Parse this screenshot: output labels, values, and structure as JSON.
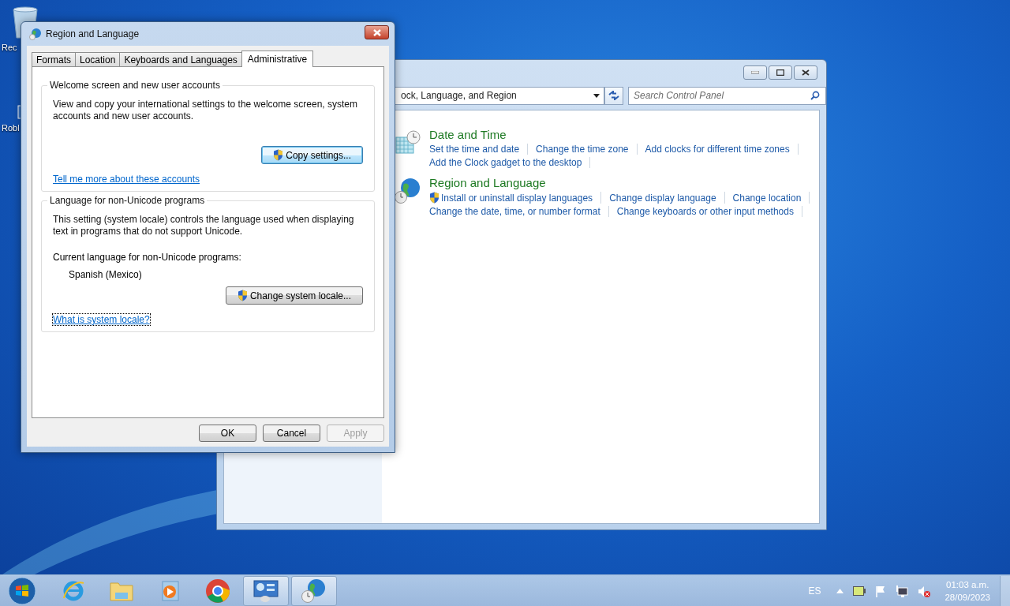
{
  "desktop_icons": [
    {
      "kind": "recycle-bin",
      "label": "Rec"
    },
    {
      "kind": "shortcut",
      "label": "Robl"
    }
  ],
  "control_panel": {
    "address": "ock, Language, and Region",
    "search": {
      "placeholder": "Search Control Panel"
    },
    "categories": [
      {
        "kind": "clock",
        "title": "Date and Time",
        "link_rows": [
          [
            {
              "label": "Set the time and date",
              "shield": false
            },
            {
              "label": "Change the time zone",
              "shield": false
            },
            {
              "label": "Add clocks for different time zones",
              "shield": false
            }
          ],
          [
            {
              "label": "Add the Clock gadget to the desktop",
              "shield": false
            }
          ]
        ]
      },
      {
        "kind": "globe",
        "title": "Region and Language",
        "link_rows": [
          [
            {
              "label": "Install or uninstall display languages",
              "shield": true
            },
            {
              "label": "Change display language",
              "shield": false
            },
            {
              "label": "Change location",
              "shield": false
            }
          ],
          [
            {
              "label": "Change the date, time, or number format",
              "shield": false
            },
            {
              "label": "Change keyboards or other input methods",
              "shield": false
            }
          ]
        ]
      }
    ]
  },
  "dialog": {
    "title": "Region and Language",
    "tabs": [
      {
        "label": "Formats",
        "selected": false
      },
      {
        "label": "Location",
        "selected": false
      },
      {
        "label": "Keyboards and Languages",
        "selected": false
      },
      {
        "label": "Administrative",
        "selected": true
      }
    ],
    "groups": [
      {
        "legend": "Welcome screen and new user accounts",
        "text": "View and copy your international settings to the welcome screen, system accounts and new user accounts.",
        "button": {
          "label": "Copy settings...",
          "shield": true,
          "default": true
        },
        "link": {
          "label": "Tell me more about these accounts",
          "focused": false
        }
      },
      {
        "legend": "Language for non-Unicode programs",
        "text": "This setting (system locale) controls the language used when displaying text in programs that do not support Unicode.",
        "current_label": "Current language for non-Unicode programs:",
        "current_value": "Spanish (Mexico)",
        "button": {
          "label": "Change system locale...",
          "shield": true,
          "default": false
        },
        "link": {
          "label": "What is system locale?",
          "focused": true
        }
      }
    ],
    "buttons": [
      {
        "label": "OK",
        "disabled": false
      },
      {
        "label": "Cancel",
        "disabled": false
      },
      {
        "label": "Apply",
        "disabled": true
      }
    ]
  },
  "taskbar": {
    "apps": [
      {
        "kind": "ie",
        "open": false
      },
      {
        "kind": "explorer",
        "open": false
      },
      {
        "kind": "media",
        "open": false
      },
      {
        "kind": "chrome",
        "open": false
      },
      {
        "kind": "control-panel",
        "open": true
      },
      {
        "kind": "region",
        "open": true
      }
    ]
  },
  "tray": {
    "language": "ES",
    "time": "01:03 a.m.",
    "date": "28/09/2023"
  }
}
